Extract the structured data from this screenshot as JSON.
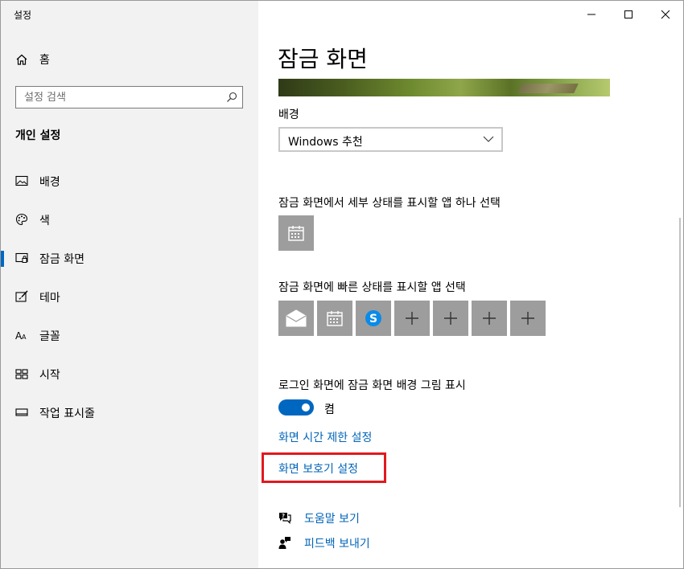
{
  "window": {
    "app_title": "설정",
    "controls": [
      "minimize-icon",
      "maximize-icon",
      "close-icon"
    ]
  },
  "sidebar": {
    "home_label": "홈",
    "search_placeholder": "설정 검색",
    "section_title": "개인 설정",
    "items": [
      {
        "label": "배경",
        "icon": "image-icon",
        "active": false
      },
      {
        "label": "색",
        "icon": "palette-icon",
        "active": false
      },
      {
        "label": "잠금 화면",
        "icon": "lock-screen-icon",
        "active": true
      },
      {
        "label": "테마",
        "icon": "theme-brush-icon",
        "active": false
      },
      {
        "label": "글꼴",
        "icon": "font-icon",
        "active": false
      },
      {
        "label": "시작",
        "icon": "start-grid-icon",
        "active": false
      },
      {
        "label": "작업 표시줄",
        "icon": "taskbar-icon",
        "active": false
      }
    ]
  },
  "main": {
    "page_title": "잠금 화면",
    "background_label": "배경",
    "background_value": "Windows 추천",
    "detailed_status_label": "잠금 화면에서 세부 상태를 표시할 앱 하나 선택",
    "detailed_status_tile": "calendar-icon",
    "quick_status_label": "잠금 화면에 빠른 상태를 표시할 앱 선택",
    "quick_status_tiles": [
      "mail-icon",
      "calendar-icon",
      "skype-icon",
      "plus-icon",
      "plus-icon",
      "plus-icon",
      "plus-icon"
    ],
    "signin_bg_label": "로그인 화면에 잠금 화면 배경 그림 표시",
    "toggle_state": "켬",
    "toggle_on": true,
    "screen_timeout_link": "화면 시간 제한 설정",
    "screensaver_link": "화면 보호기 설정",
    "help_link": "도움말 보기",
    "feedback_link": "피드백 보내기"
  },
  "colors": {
    "accent": "#0067c0",
    "link": "#0064b8",
    "highlight": "#e0191f",
    "tile": "#9d9d9d",
    "sidebar_bg": "#f2f2f2"
  }
}
